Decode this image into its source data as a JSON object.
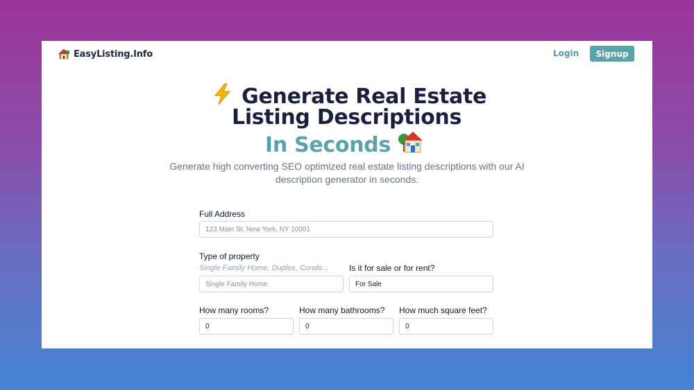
{
  "header": {
    "brand_name": "EasyListing.Info",
    "login_label": "Login",
    "signup_label": "Signup"
  },
  "hero": {
    "line1": "Generate Real Estate",
    "line2": "Listing Descriptions",
    "line3": "In Seconds",
    "subtitle": "Generate high converting SEO optimized real estate listing descriptions with our AI description generator in seconds."
  },
  "form": {
    "address": {
      "label": "Full Address",
      "placeholder": "123 Main St, New York, NY 10001",
      "value": ""
    },
    "property_type": {
      "label": "Type of property",
      "hint": "Single Family Home, Duplex, Condo...",
      "placeholder": "Single Family Home",
      "value": ""
    },
    "sale_or_rent": {
      "label": "Is it for sale or for rent?",
      "value": "For Sale"
    },
    "rooms": {
      "label": "How many rooms?",
      "value": "0"
    },
    "bathrooms": {
      "label": "How many bathrooms?",
      "value": "0"
    },
    "square_feet": {
      "label": "How much square feet?",
      "value": "0"
    }
  },
  "icons": {
    "brand": "house-icon",
    "hero_lead": "lightning-bolt-icon",
    "hero_trail": "house-icon"
  },
  "colors": {
    "accent": "#5aa3a6",
    "heading": "#1b1f3b",
    "background_top": "#9b3597",
    "background_bottom": "#4584d0"
  }
}
